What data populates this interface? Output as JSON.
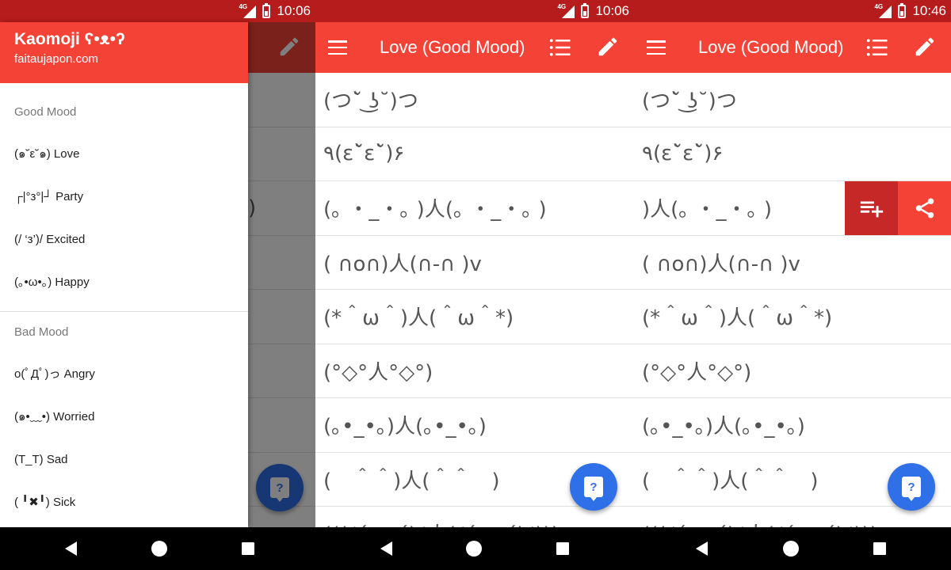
{
  "colors": {
    "primary": "#f44336",
    "primary_dark": "#b71c1c",
    "fab": "#2f6fe8",
    "action_dark": "#c62828"
  },
  "status_bar": {
    "network": "4G",
    "time_1": "10:06",
    "time_2": "10:06",
    "time_3": "10:46"
  },
  "drawer": {
    "title": "Kaomoji ʕ•ᴥ•ʔ",
    "subtitle": "faitaujapon.com",
    "sections": [
      {
        "header": "Good Mood",
        "items": [
          "(๑˘ε˘๑) Love",
          "┌|°з°|┘ Party",
          "(/ ‘з’)/ Excited",
          "(｡•ω•｡) Happy"
        ]
      },
      {
        "header": "Bad Mood",
        "items": [
          "o(ﾟДﾟ)っ Angry",
          "(๑•﹏•) Worried",
          "(T_T) Sad",
          "( ╹✖╹) Sick"
        ]
      }
    ]
  },
  "drawer_peek_text": ")",
  "appbar": {
    "title": "Love (Good Mood)"
  },
  "kaomoji_list": [
    "(つ˘̀ ͜ʖ˘)つ",
    "٩(ε˘̀ε˘̀)۶",
    "(｡ ・_・｡ )人(｡ ・_・｡ )",
    "( ∩o∩)人(∩-∩ )v",
    "(*＾ω＾)人(＾ω＾*)",
    "(°◇°人°◇°)",
    "(｡•_•｡)人(｡•_•｡)",
    "(　＾＾)人(＾＾　)",
    "(((ﾉ´ ω ´)ﾉ人(ﾉ´ ω ´)ﾉ)))"
  ],
  "swiped_row_text": ")人(｡ ・_・｡ )",
  "icons": {
    "menu": "hamburger-menu-icon",
    "list": "list-view-icon",
    "edit": "pencil-edit-icon",
    "add_to_list": "playlist-add-icon",
    "share": "share-icon",
    "help": "help-chat-icon",
    "back": "back-triangle-icon",
    "home": "home-circle-icon",
    "recents": "recents-square-icon"
  }
}
